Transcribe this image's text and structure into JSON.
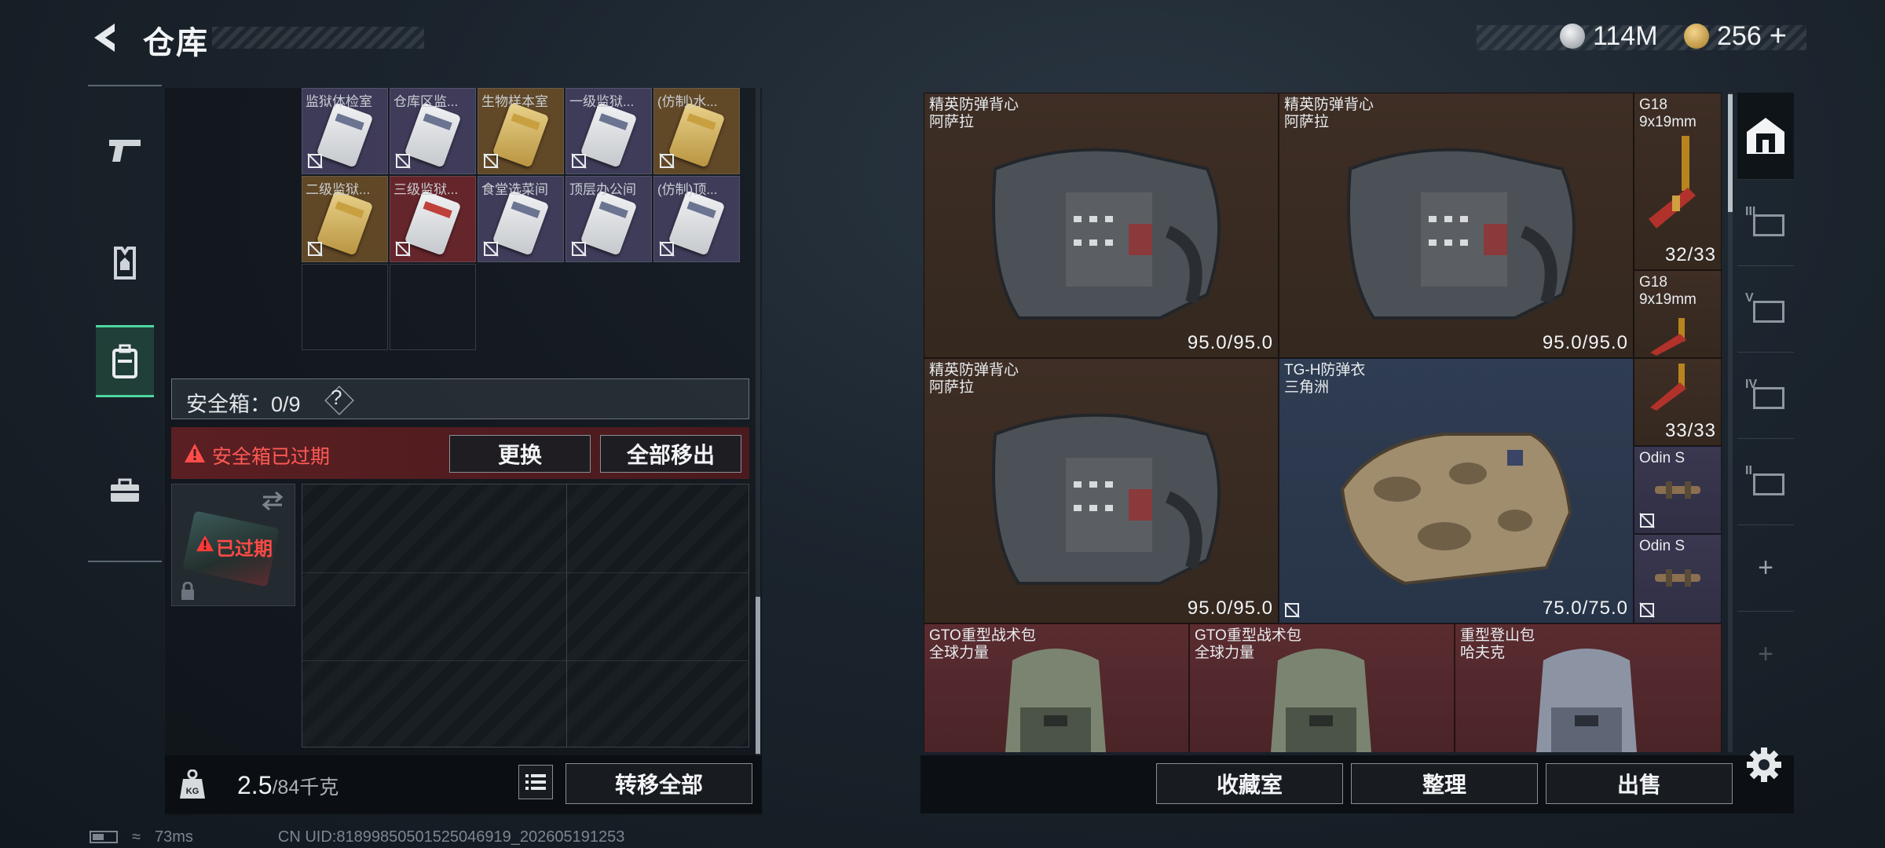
{
  "header": {
    "title": "仓库"
  },
  "currency": [
    {
      "name": "silver-coin",
      "value": "114M",
      "color": "#c8ccd2"
    },
    {
      "name": "gold-coin",
      "value": "256",
      "color": "#d6a94a",
      "plus": "+"
    }
  ],
  "left_nav": [
    {
      "icon": "pistol-icon"
    },
    {
      "icon": "vest-icon"
    },
    {
      "icon": "backpack-icon",
      "active": true
    },
    {
      "icon": "toolbox-icon"
    }
  ],
  "keycards": [
    {
      "label": "监狱体检室",
      "color": "purple"
    },
    {
      "label": "仓库区监...",
      "color": "purple"
    },
    {
      "label": "生物样本室",
      "color": "gold"
    },
    {
      "label": "一级监狱...",
      "color": "purple"
    },
    {
      "label": "(仿制)水...",
      "color": "gold"
    },
    {
      "label": "二级监狱...",
      "color": "gold"
    },
    {
      "label": "三级监狱...",
      "color": "red"
    },
    {
      "label": "食堂选菜间",
      "color": "purple"
    },
    {
      "label": "顶层办公间",
      "color": "purple"
    },
    {
      "label": "(仿制)顶...",
      "color": "purple"
    }
  ],
  "safebox": {
    "label": "安全箱：0/9",
    "help": "?",
    "expired_warning": "安全箱已过期",
    "replace_btn": "更换",
    "remove_all_btn": "全部移出",
    "case_status": "已过期"
  },
  "inventory": {
    "weight": "2.5",
    "max_weight": "/84千克",
    "transfer_all_btn": "转移全部"
  },
  "stash_items": [
    {
      "name": "精英防弹背心",
      "sub": "阿萨拉",
      "durability": "95.0/95.0",
      "color": "brown",
      "kind": "vest-dark"
    },
    {
      "name": "精英防弹背心",
      "sub": "阿萨拉",
      "durability": "95.0/95.0",
      "color": "brown",
      "kind": "vest-dark"
    },
    {
      "name": "G18",
      "sub": "9x19mm",
      "durability": "32/33",
      "color": "brown",
      "kind": "mag"
    },
    {
      "name": "G18",
      "sub": "9x19mm",
      "durability": "",
      "color": "brown",
      "kind": "mag"
    },
    {
      "name": "精英防弹背心",
      "sub": "阿萨拉",
      "durability": "95.0/95.0",
      "color": "brown",
      "kind": "vest-dark"
    },
    {
      "name": "TG-H防弹衣",
      "sub": "三角洲",
      "durability": "75.0/75.0",
      "color": "blue",
      "kind": "vest-camo"
    },
    {
      "name": "",
      "sub": "",
      "durability": "33/33",
      "color": "brown",
      "kind": "mag"
    },
    {
      "name": "Odin S",
      "sub": "",
      "durability": "",
      "color": "purple",
      "kind": "scope"
    },
    {
      "name": "Odin S",
      "sub": "",
      "durability": "",
      "color": "purple",
      "kind": "scope"
    },
    {
      "name": "GTO重型战术包",
      "sub": "全球力量",
      "durability": "",
      "color": "red",
      "kind": "bag-green"
    },
    {
      "name": "GTO重型战术包",
      "sub": "全球力量",
      "durability": "",
      "color": "red",
      "kind": "bag-green"
    },
    {
      "name": "重型登山包",
      "sub": "哈夫克",
      "durability": "",
      "color": "red",
      "kind": "bag-grey"
    }
  ],
  "stash_actions": {
    "collection_btn": "收藏室",
    "sort_btn": "整理",
    "sell_btn": "出售"
  },
  "right_tabs": [
    {
      "icon": "home-icon",
      "active": true
    },
    {
      "icon": "stash-3-icon",
      "label": "III"
    },
    {
      "icon": "stash-5-icon",
      "label": "V"
    },
    {
      "icon": "stash-4-icon",
      "label": "IV"
    },
    {
      "icon": "stash-2-icon",
      "label": "II"
    },
    {
      "icon": "add-tab-icon",
      "label": "+"
    },
    {
      "icon": "add-tab-disabled-icon",
      "label": "+"
    }
  ],
  "status": {
    "ping": "73ms",
    "uid": "CN UID:8189985050152504691​9_202605191253"
  }
}
